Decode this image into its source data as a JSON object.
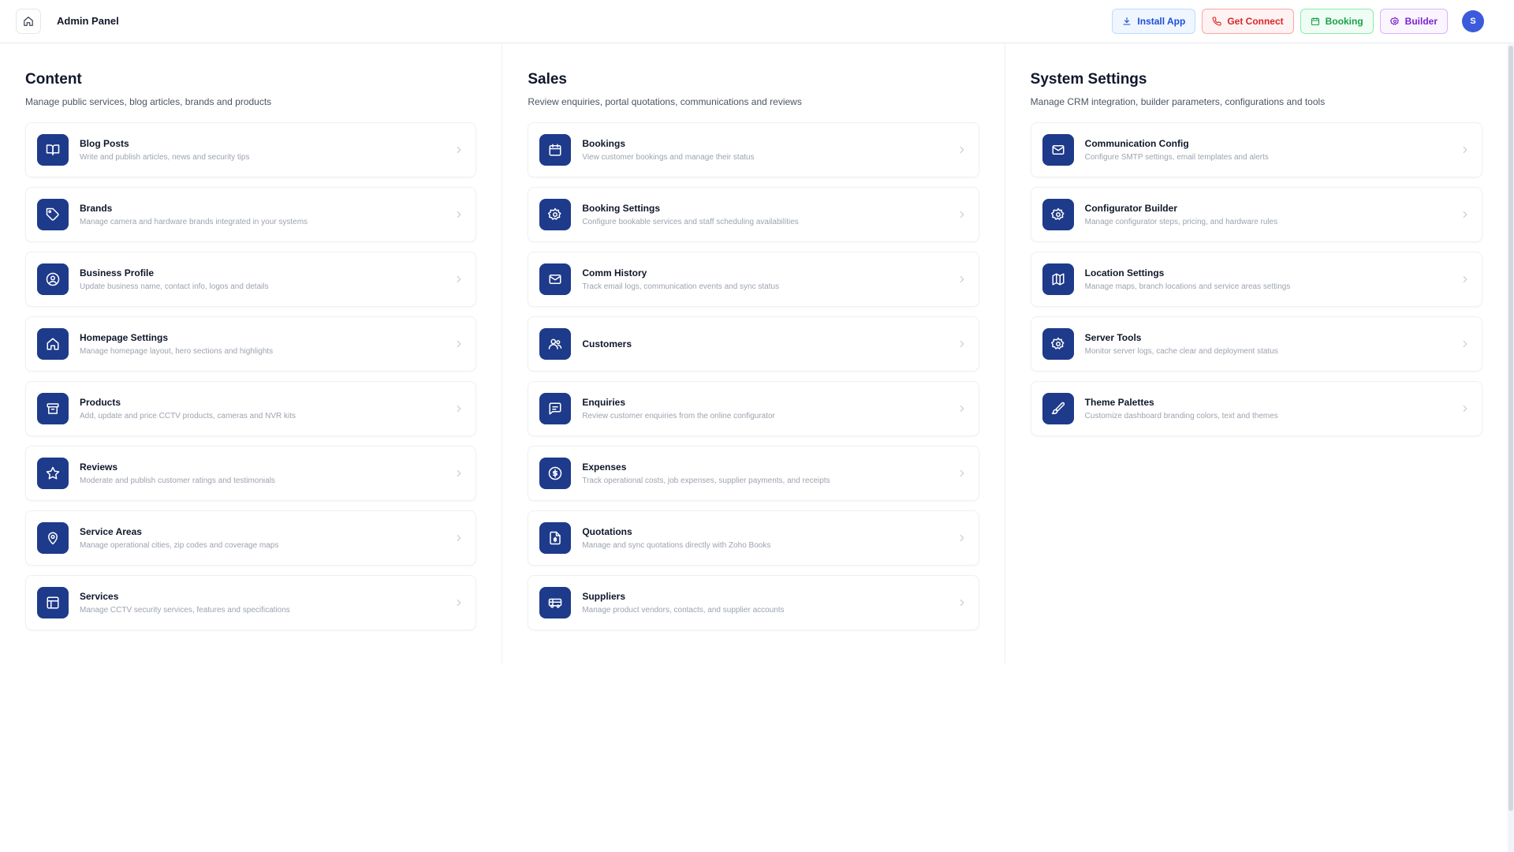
{
  "header": {
    "title": "Admin Panel",
    "home_icon": "home-icon",
    "actions": [
      {
        "label": "Install App",
        "icon": "download-icon",
        "color": "#1d4ed8"
      },
      {
        "label": "Get Connect",
        "icon": "phone-icon",
        "color": "#dc2626"
      },
      {
        "label": "Booking",
        "icon": "calendar-icon",
        "color": "#16a34a"
      },
      {
        "label": "Builder",
        "icon": "gear-icon",
        "color": "#7e22ce"
      }
    ],
    "avatar": "S"
  },
  "colors": {
    "accent": "#1e3a8a"
  },
  "sections": [
    {
      "title": "Content",
      "description": "Manage public services, blog articles, brands and products",
      "items": [
        {
          "title": "Blog Posts",
          "subtitle": "Write and publish articles, news and security tips",
          "icon": "book-icon"
        },
        {
          "title": "Brands",
          "subtitle": "Manage camera and hardware brands integrated in your systems",
          "icon": "tag-icon"
        },
        {
          "title": "Business Profile",
          "subtitle": "Update business name, contact info, logos and details",
          "icon": "user-circle-icon"
        },
        {
          "title": "Homepage Settings",
          "subtitle": "Manage homepage layout, hero sections and highlights",
          "icon": "home-icon"
        },
        {
          "title": "Products",
          "subtitle": "Add, update and price CCTV products, cameras and NVR kits",
          "icon": "archive-icon"
        },
        {
          "title": "Reviews",
          "subtitle": "Moderate and publish customer ratings and testimonials",
          "icon": "star-icon"
        },
        {
          "title": "Service Areas",
          "subtitle": "Manage operational cities, zip codes and coverage maps",
          "icon": "map-pin-icon"
        },
        {
          "title": "Services",
          "subtitle": "Manage CCTV security services, features and specifications",
          "icon": "layout-icon"
        }
      ]
    },
    {
      "title": "Sales",
      "description": "Review enquiries, portal quotations, communications and reviews",
      "items": [
        {
          "title": "Bookings",
          "subtitle": "View customer bookings and manage their status",
          "icon": "calendar-icon"
        },
        {
          "title": "Booking Settings",
          "subtitle": "Configure bookable services and staff scheduling availabilities",
          "icon": "gear-icon"
        },
        {
          "title": "Comm History",
          "subtitle": "Track email logs, communication events and sync status",
          "icon": "mail-icon"
        },
        {
          "title": "Customers",
          "subtitle": "",
          "icon": "users-icon"
        },
        {
          "title": "Enquiries",
          "subtitle": "Review customer enquiries from the online configurator",
          "icon": "message-icon"
        },
        {
          "title": "Expenses",
          "subtitle": "Track operational costs, job expenses, supplier payments, and receipts",
          "icon": "dollar-circle-icon"
        },
        {
          "title": "Quotations",
          "subtitle": "Manage and sync quotations directly with Zoho Books",
          "icon": "file-dollar-icon"
        },
        {
          "title": "Suppliers",
          "subtitle": "Manage product vendors, contacts, and supplier accounts",
          "icon": "truck-icon"
        }
      ]
    },
    {
      "title": "System Settings",
      "description": "Manage CRM integration, builder parameters, configurations and tools",
      "items": [
        {
          "title": "Communication Config",
          "subtitle": "Configure SMTP settings, email templates and alerts",
          "icon": "mail-icon"
        },
        {
          "title": "Configurator Builder",
          "subtitle": "Manage configurator steps, pricing, and hardware rules",
          "icon": "gear-icon"
        },
        {
          "title": "Location Settings",
          "subtitle": "Manage maps, branch locations and service areas settings",
          "icon": "map-icon"
        },
        {
          "title": "Server Tools",
          "subtitle": "Monitor server logs, cache clear and deployment status",
          "icon": "gear-icon"
        },
        {
          "title": "Theme Palettes",
          "subtitle": "Customize dashboard branding colors, text and themes",
          "icon": "brush-icon"
        }
      ]
    }
  ]
}
